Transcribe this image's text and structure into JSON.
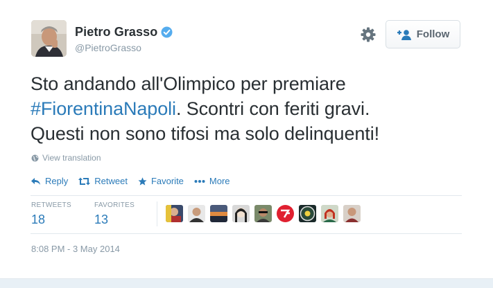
{
  "user": {
    "display_name": "Pietro Grasso",
    "handle": "@PietroGrasso"
  },
  "follow_button": {
    "label": "Follow"
  },
  "tweet": {
    "line1": "Sto andando all'Olimpico per premiare",
    "hashtag": "#FiorentinaNapoli",
    "line2_rest": ". Scontri con feriti gravi.",
    "line3": "Questi non sono tifosi ma solo delinquenti!"
  },
  "translate": {
    "label": "View translation"
  },
  "actions": {
    "reply": "Reply",
    "retweet": "Retweet",
    "favorite": "Favorite",
    "more": "More"
  },
  "stats": {
    "retweets_label": "RETWEETS",
    "retweets_value": "18",
    "favorites_label": "FAVORITES",
    "favorites_value": "13"
  },
  "timestamp": "8:08 PM - 3 May 2014",
  "colors": {
    "link": "#2b7bb9",
    "muted": "#8899a6",
    "verified": "#55acee"
  }
}
